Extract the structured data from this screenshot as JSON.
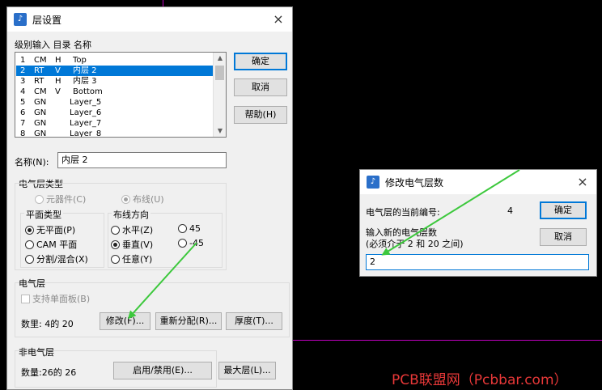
{
  "layer_dialog": {
    "title": "层设置",
    "close": "×",
    "header": "级别输入 目录 名称",
    "rows": [
      {
        "num": "1",
        "type": "CM",
        "dir": "H",
        "name": "Top"
      },
      {
        "num": "2",
        "type": "RT",
        "dir": "V",
        "name": "内层 2"
      },
      {
        "num": "3",
        "type": "RT",
        "dir": "H",
        "name": "内层 3"
      },
      {
        "num": "4",
        "type": "CM",
        "dir": "V",
        "name": "Bottom"
      },
      {
        "num": "5",
        "type": "GN",
        "dir": "",
        "name": "Layer_5"
      },
      {
        "num": "6",
        "type": "GN",
        "dir": "",
        "name": "Layer_6"
      },
      {
        "num": "7",
        "type": "GN",
        "dir": "",
        "name": "Layer_7"
      },
      {
        "num": "8",
        "type": "GN",
        "dir": "",
        "name": "Layer_8"
      }
    ],
    "selected_row": 1,
    "buttons": {
      "ok": "确定",
      "cancel": "取消",
      "help": "帮助(H)"
    },
    "name_label": "名称(N):",
    "name_value": "内层 2",
    "elec_type": {
      "label": "电气层类型",
      "component": "元器件(C)",
      "routing": "布线(U)"
    },
    "plane_type": {
      "label": "平面类型",
      "none": "无平面(P)",
      "cam": "CAM 平面",
      "split": "分割/混合(X)"
    },
    "routing_dir": {
      "label": "布线方向",
      "horizontal": "水平(Z)",
      "vertical": "垂直(V)",
      "any": "任意(Y)",
      "d45": "45",
      "dm45": "-45"
    },
    "elec_layers": {
      "label": "电气层",
      "single_sided": "支持单面板(B)",
      "count": "数里: 4的 20",
      "modify": "修改(F)...",
      "reassign": "重新分配(R)...",
      "thickness": "厚度(T)..."
    },
    "nonelec_layers": {
      "label": "非电气层",
      "count": "数量:26的 26",
      "enable": "启用/禁用(E)...",
      "max": "最大层(L)..."
    }
  },
  "modify_dialog": {
    "title": "修改电气层数",
    "close": "×",
    "current_label": "电气层的当前编号:",
    "current_value": "4",
    "new_label": "输入新的电气层数",
    "range_hint": "(必须介于 2 和 20 之间)",
    "input_value": "2",
    "ok": "确定",
    "cancel": "取消"
  },
  "watermark": "PCB联盟网（Pcbbar.com）",
  "colors": {
    "arrow": "#3cc83c",
    "selection": "#0078d7",
    "guide": "#c000c0",
    "watermark": "#e83838"
  }
}
